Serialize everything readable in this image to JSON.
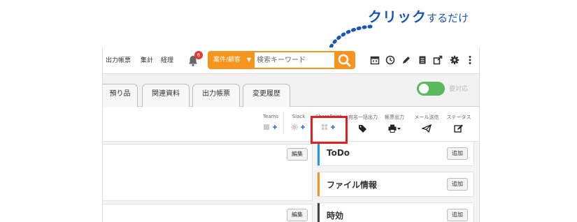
{
  "annotation": {
    "strong": "クリック",
    "rest": "するだけ"
  },
  "header": {
    "nav": [
      "出力帳票",
      "集計",
      "経理"
    ],
    "notification_count": "6",
    "search": {
      "category": "案件/顧客",
      "placeholder": "検索キーワード"
    },
    "tool_icons": [
      "calendar-icon",
      "clock-icon",
      "pen-icon",
      "document-icon",
      "external-link-icon",
      "gear-icon",
      "more-vertical-icon"
    ]
  },
  "tabs": [
    "預り品",
    "関連資料",
    "出力帳票",
    "変更履歴"
  ],
  "toggle": {
    "label": "要対応"
  },
  "actions": [
    {
      "label": "Teams",
      "icon": "teams-add-icon"
    },
    {
      "label": "Slack",
      "icon": "slack-add-icon"
    },
    {
      "label": "SharePoint",
      "icon": "sharepoint-add-icon"
    },
    {
      "label": "宛名一括出力",
      "icon": "tags-icon"
    },
    {
      "label": "帳票出力",
      "icon": "printer-icon"
    },
    {
      "label": "メール送信",
      "icon": "send-icon"
    },
    {
      "label": "ステータス",
      "icon": "edit-status-icon"
    }
  ],
  "left_panels": {
    "edit_label": "編集"
  },
  "cards": [
    {
      "title": "ToDo",
      "color": "#2196f3",
      "add_label": "追加"
    },
    {
      "title": "ファイル情報",
      "color": "#f7941d",
      "add_label": "追加"
    },
    {
      "title": "時効",
      "color": "#444444",
      "add_label": "追加"
    }
  ],
  "colors": {
    "accent": "#f7941d",
    "highlight": "#e02020",
    "annotation": "#1a56b8",
    "toggle": "#5cb85c"
  }
}
